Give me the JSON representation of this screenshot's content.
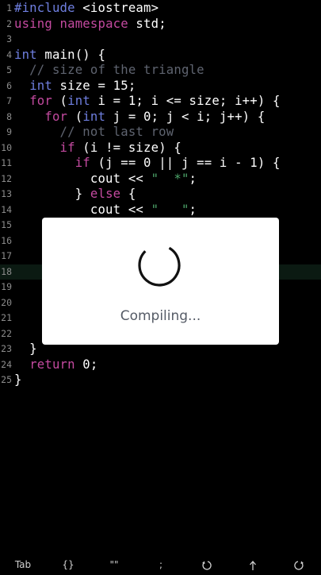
{
  "editor": {
    "highlight_line": 18,
    "lines": [
      {
        "n": "1",
        "segs": [
          {
            "t": "#include",
            "c": "pp"
          },
          {
            "t": " <iostream>",
            "c": ""
          }
        ]
      },
      {
        "n": "2",
        "segs": [
          {
            "t": "using",
            "c": "kw"
          },
          {
            "t": " ",
            "c": ""
          },
          {
            "t": "namespace",
            "c": "kw"
          },
          {
            "t": " std;",
            "c": ""
          }
        ]
      },
      {
        "n": "3",
        "segs": []
      },
      {
        "n": "4",
        "segs": [
          {
            "t": "int",
            "c": "ty"
          },
          {
            "t": " main() {",
            "c": ""
          }
        ]
      },
      {
        "n": "5",
        "segs": [
          {
            "t": "  // size of the triangle",
            "c": "cm"
          }
        ]
      },
      {
        "n": "6",
        "segs": [
          {
            "t": "  ",
            "c": ""
          },
          {
            "t": "int",
            "c": "ty"
          },
          {
            "t": " size = 15;",
            "c": ""
          }
        ]
      },
      {
        "n": "7",
        "segs": [
          {
            "t": "  ",
            "c": ""
          },
          {
            "t": "for",
            "c": "kw"
          },
          {
            "t": " (",
            "c": ""
          },
          {
            "t": "int",
            "c": "ty"
          },
          {
            "t": " i = 1; i <= size; i++) {",
            "c": ""
          }
        ]
      },
      {
        "n": "8",
        "segs": [
          {
            "t": "    ",
            "c": ""
          },
          {
            "t": "for",
            "c": "kw"
          },
          {
            "t": " (",
            "c": ""
          },
          {
            "t": "int",
            "c": "ty"
          },
          {
            "t": " j = 0; j < i; j++) {",
            "c": ""
          }
        ]
      },
      {
        "n": "9",
        "segs": [
          {
            "t": "      // not last row",
            "c": "cm"
          }
        ]
      },
      {
        "n": "10",
        "segs": [
          {
            "t": "      ",
            "c": ""
          },
          {
            "t": "if",
            "c": "kw"
          },
          {
            "t": " (i != size) {",
            "c": ""
          }
        ]
      },
      {
        "n": "11",
        "segs": [
          {
            "t": "        ",
            "c": ""
          },
          {
            "t": "if",
            "c": "kw"
          },
          {
            "t": " (j == 0 || j == i - 1) {",
            "c": ""
          }
        ]
      },
      {
        "n": "12",
        "segs": [
          {
            "t": "          cout << ",
            "c": ""
          },
          {
            "t": "\"  *\"",
            "c": "st"
          },
          {
            "t": ";",
            "c": ""
          }
        ]
      },
      {
        "n": "13",
        "segs": [
          {
            "t": "        } ",
            "c": ""
          },
          {
            "t": "else",
            "c": "kw"
          },
          {
            "t": " {",
            "c": ""
          }
        ]
      },
      {
        "n": "14",
        "segs": [
          {
            "t": "          cout << ",
            "c": ""
          },
          {
            "t": "\"   \"",
            "c": "st"
          },
          {
            "t": ";",
            "c": ""
          }
        ]
      },
      {
        "n": "15",
        "segs": []
      },
      {
        "n": "16",
        "segs": []
      },
      {
        "n": "17",
        "segs": []
      },
      {
        "n": "18",
        "segs": []
      },
      {
        "n": "19",
        "segs": []
      },
      {
        "n": "20",
        "segs": []
      },
      {
        "n": "21",
        "segs": []
      },
      {
        "n": "22",
        "segs": []
      },
      {
        "n": "23",
        "segs": [
          {
            "t": "  }",
            "c": ""
          }
        ]
      },
      {
        "n": "24",
        "segs": [
          {
            "t": "  ",
            "c": ""
          },
          {
            "t": "return",
            "c": "kw"
          },
          {
            "t": " 0;",
            "c": ""
          }
        ]
      },
      {
        "n": "25",
        "segs": [
          {
            "t": "}",
            "c": ""
          }
        ]
      }
    ]
  },
  "dialog": {
    "message": "Compiling...",
    "spinner_icon": "loading-spinner-icon"
  },
  "toolbar": {
    "tab": "Tab",
    "braces": "{}",
    "quotes": "\"\"",
    "semicolon": ";",
    "undo_icon": "undo-icon",
    "up_icon": "arrow-up-icon",
    "redo_icon": "redo-icon"
  }
}
